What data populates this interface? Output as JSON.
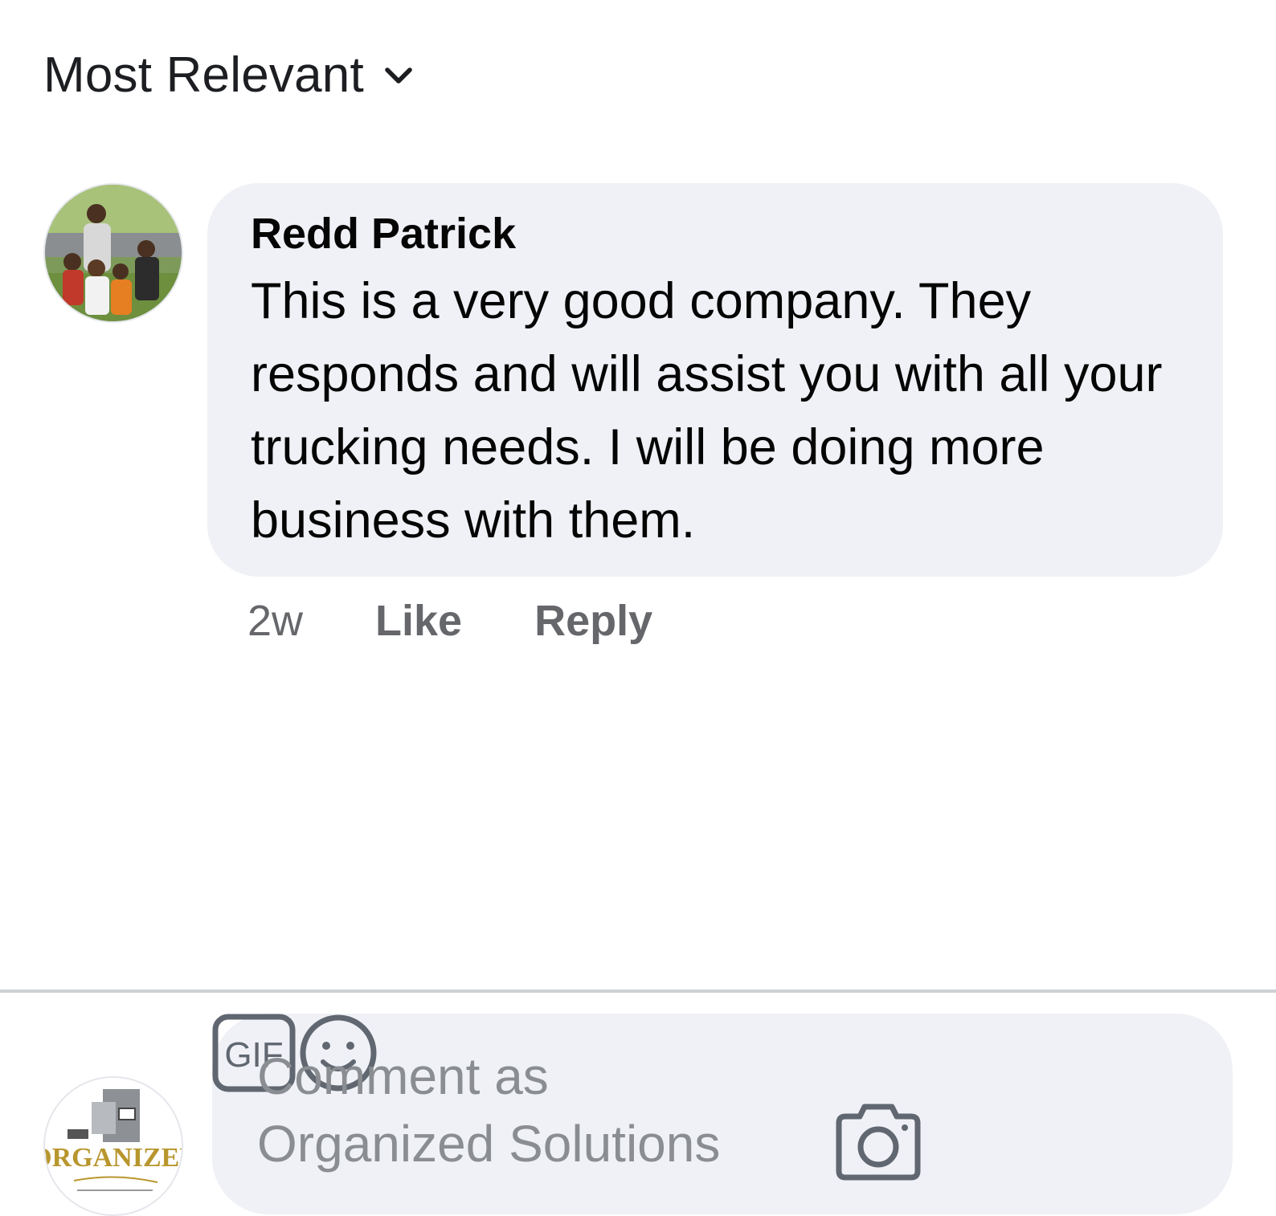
{
  "sort": {
    "label": "Most Relevant",
    "icon": "chevron-down-icon"
  },
  "comment": {
    "author": "Redd Patrick",
    "text": "This is a very good company. They responds and will assist you with all your trucking needs. I will be doing more business with them.",
    "time": "2w",
    "like_label": "Like",
    "reply_label": "Reply"
  },
  "composer": {
    "placeholder_line1": "Comment as",
    "placeholder_line2": "Organized Solutions",
    "logo_text": "ORGANIZED",
    "icons": [
      "camera-icon",
      "gif-icon",
      "emoji-icon"
    ],
    "gif_label": "GIF"
  },
  "colors": {
    "bubble": "#f0f1f6",
    "secondary_text": "#65676b",
    "placeholder": "#8a8d91",
    "icon_stroke": "#606770"
  }
}
